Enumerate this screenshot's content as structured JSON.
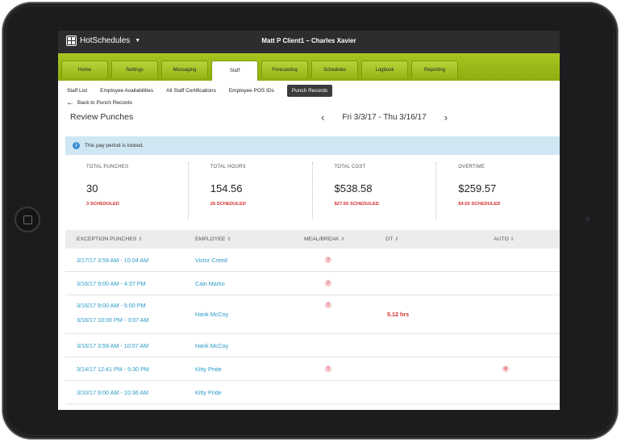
{
  "app": {
    "logo_text": "HotSchedules",
    "title": "Matt P Client1 – Charles Xavier"
  },
  "tabs": [
    {
      "label": "Home"
    },
    {
      "label": "Settings"
    },
    {
      "label": "Messaging"
    },
    {
      "label": "Staff",
      "active": true
    },
    {
      "label": "Forecasting"
    },
    {
      "label": "Schedules"
    },
    {
      "label": "Logbook"
    },
    {
      "label": "Reporting"
    }
  ],
  "subnav": [
    {
      "label": "Staff List"
    },
    {
      "label": "Employee Availabilities"
    },
    {
      "label": "All Staff Certifications"
    },
    {
      "label": "Employee POS IDs"
    },
    {
      "label": "Punch Records",
      "selected": true
    }
  ],
  "back_label": "Back to Punch Records",
  "page_title": "Review Punches",
  "date_range": "Fri 3/3/17 - Thu 3/16/17",
  "alert": "This pay period is locked.",
  "stats": [
    {
      "label": "TOTAL PUNCHES",
      "value": "30",
      "scheduled": "3 SCHEDULED"
    },
    {
      "label": "TOTAL HOURS",
      "value": "154.56",
      "scheduled": "26 SCHEDULED"
    },
    {
      "label": "TOTAL COST",
      "value": "$538.58",
      "scheduled": "$27.50 SCHEDULED"
    },
    {
      "label": "OVERTIME",
      "value": "$259.57",
      "scheduled": "$4.50 SCHEDULED"
    }
  ],
  "table": {
    "headers": {
      "exception": "EXCEPTION PUNCHES",
      "employee": "EMPLOYEE",
      "meal": "MEAL/BREAK",
      "ot": "OT",
      "auto": "AUTO"
    },
    "rows": [
      {
        "punches": [
          "3/17/17 3:59 AM - 10:04 AM"
        ],
        "employee": "Victor Creed",
        "meal": "!",
        "ot": "",
        "auto": ""
      },
      {
        "punches": [
          "3/16/17 9:00 AM - 4:37 PM"
        ],
        "employee": "Cain Marko",
        "meal": "!",
        "ot": "",
        "auto": ""
      },
      {
        "punches": [
          "3/16/17 9:00 AM - 5:00 PM",
          "3/16/17 10:00 PM - 3:07 AM"
        ],
        "employee": "Hank McCoy",
        "meal": "!",
        "ot": "5.12 hrs",
        "auto": ""
      },
      {
        "punches": [
          "3/16/17 3:59 AM - 10:07 AM"
        ],
        "employee": "Hank McCoy",
        "meal": "",
        "ot": "",
        "auto": ""
      },
      {
        "punches": [
          "3/14/17 12:41 PM - 5:30 PM"
        ],
        "employee": "Kitty Pride",
        "meal": "!",
        "ot": "",
        "auto": "x"
      },
      {
        "punches": [
          "3/10/17 9:00 AM - 10:36 AM"
        ],
        "employee": "Kitty Pride",
        "meal": "",
        "ot": "",
        "auto": ""
      }
    ]
  }
}
